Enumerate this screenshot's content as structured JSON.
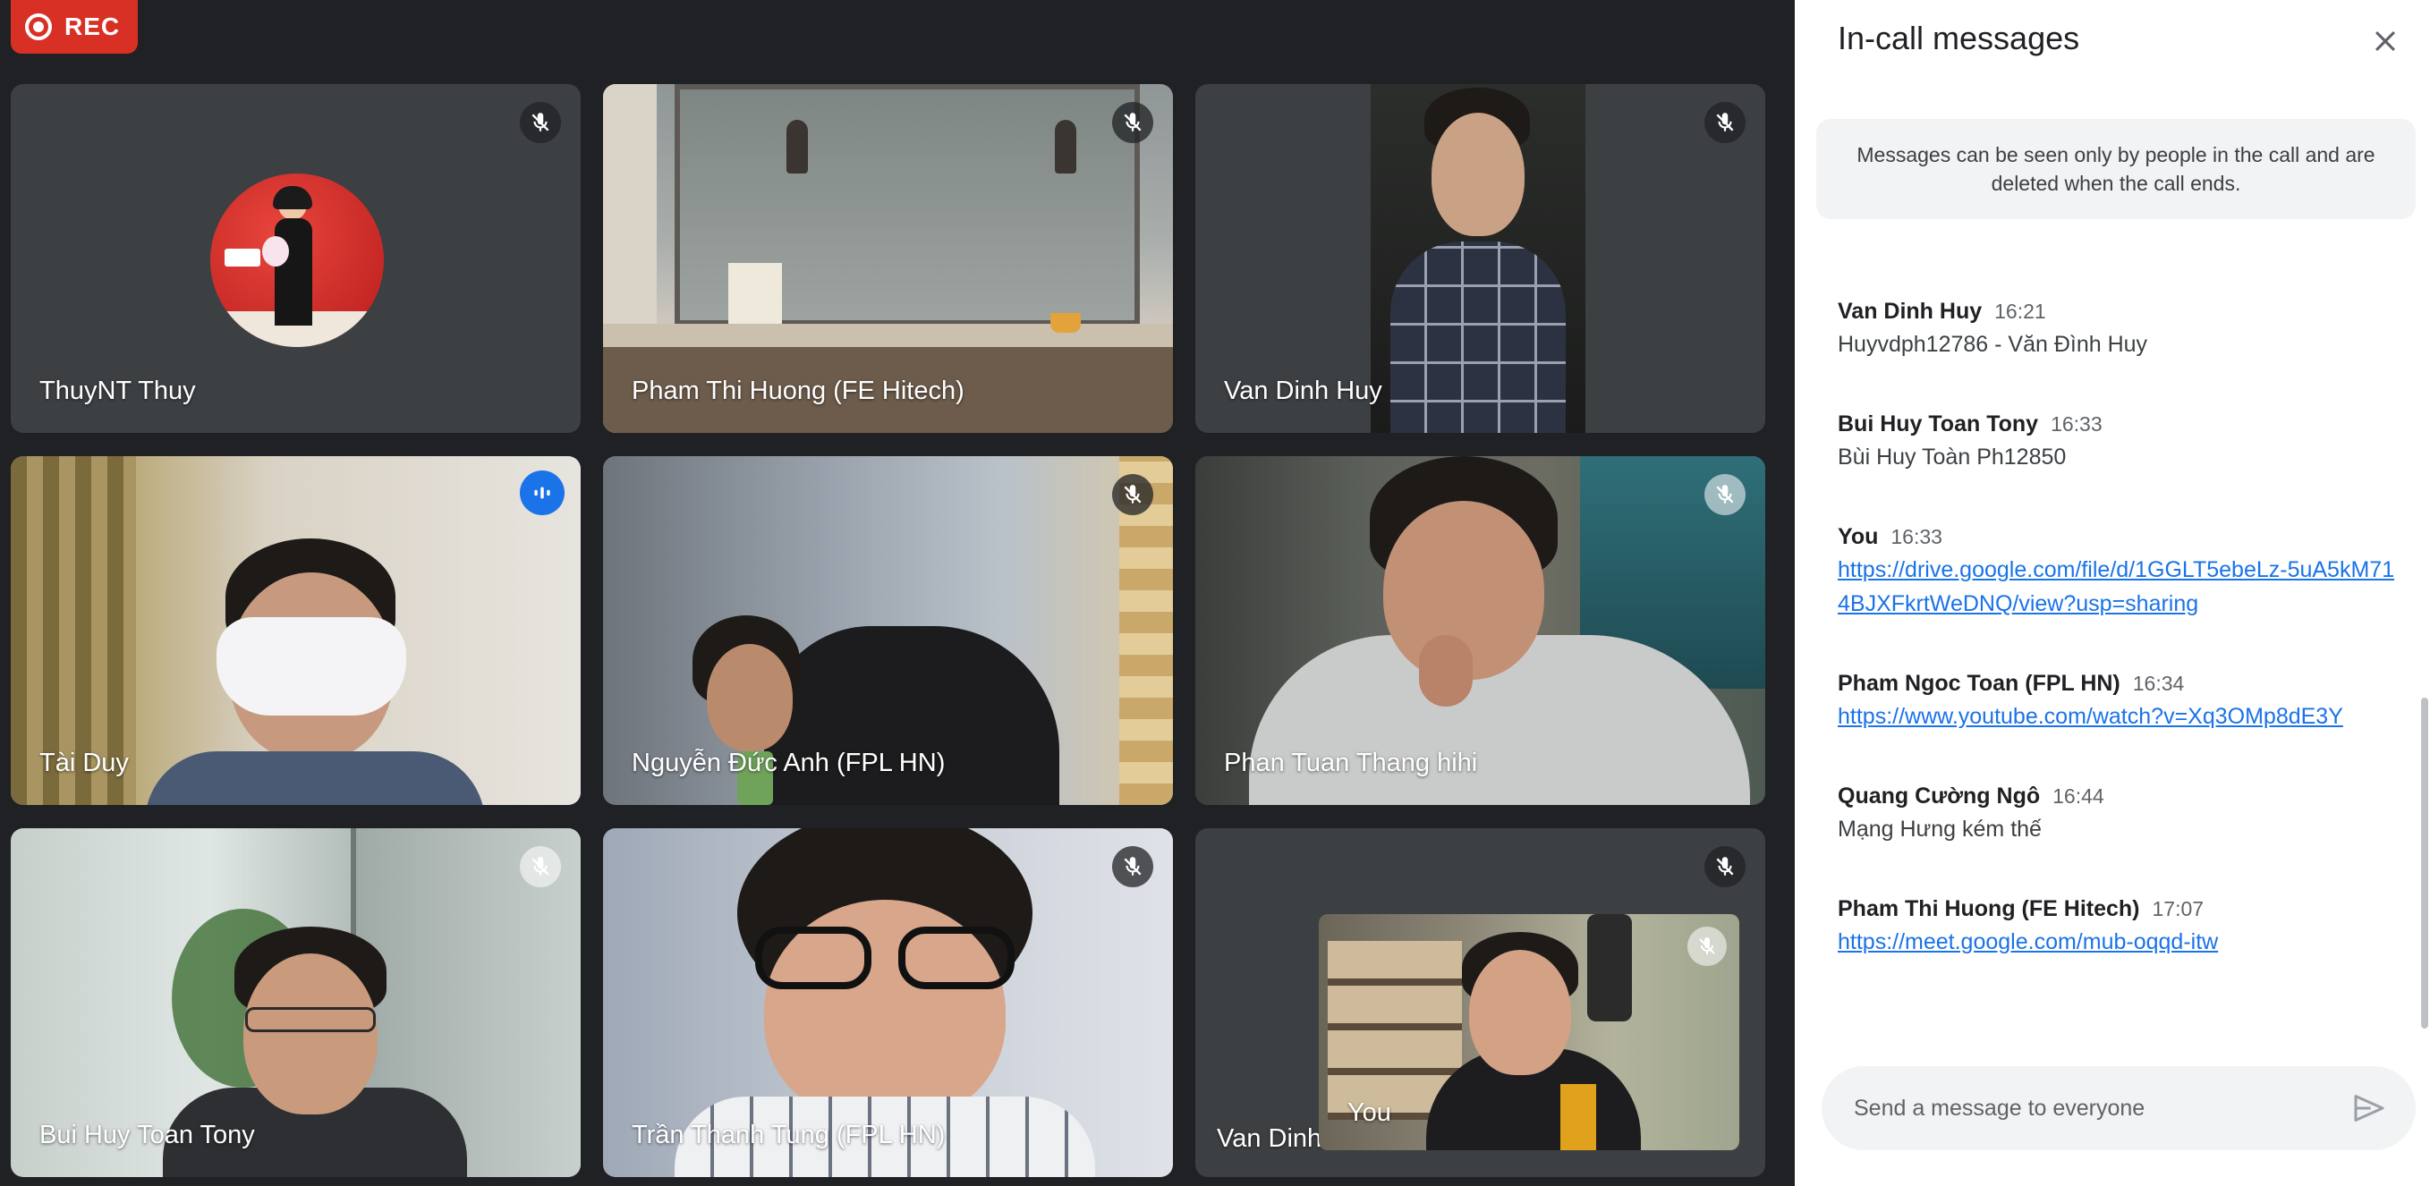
{
  "recording": {
    "label": "REC"
  },
  "tiles": [
    {
      "name": "ThuyNT Thuy"
    },
    {
      "name": "Pham Thi Huong (FE Hitech)"
    },
    {
      "name": "Van Dinh Huy"
    },
    {
      "name": "Tài Duy"
    },
    {
      "name": "Nguyễn Đức Anh (FPL HN)"
    },
    {
      "name": "Phan Tuan Thang hihi"
    },
    {
      "name": "Bui Huy Toan Tony"
    },
    {
      "name": "Trần Thanh Tung (FPL HN)"
    },
    {
      "name": "Van Dinh"
    }
  ],
  "self_view": {
    "name": "You"
  },
  "chat": {
    "title": "In-call messages",
    "notice": "Messages can be seen only by people in the call and are deleted when the call ends.",
    "messages": [
      {
        "sender": "Van Dinh Huy",
        "time": "16:21",
        "text": "Huyvdph12786 - Văn Đình Huy"
      },
      {
        "sender": "Bui Huy Toan Tony",
        "time": "16:33",
        "text": "Bùi Huy Toàn Ph12850"
      },
      {
        "sender": "You",
        "time": "16:33",
        "link": "https://drive.google.com/file/d/1GGLT5ebeLz-5uA5kM714BJXFkrtWeDNQ/view?usp=sharing"
      },
      {
        "sender": "Pham Ngoc Toan (FPL HN)",
        "time": "16:34",
        "link": "https://www.youtube.com/watch?v=Xq3OMp8dE3Y"
      },
      {
        "sender": "Quang Cường Ngô",
        "time": "16:44",
        "text": "Mạng Hưng kém thế"
      },
      {
        "sender": "Pham Thi Huong (FE Hitech)",
        "time": "17:07",
        "link": "https://meet.google.com/mub-oqqd-itw"
      }
    ],
    "input_placeholder": "Send a message to everyone"
  },
  "colors": {
    "recording": "#d93025",
    "speaking": "#1a73e8",
    "link": "#1a73e8"
  }
}
